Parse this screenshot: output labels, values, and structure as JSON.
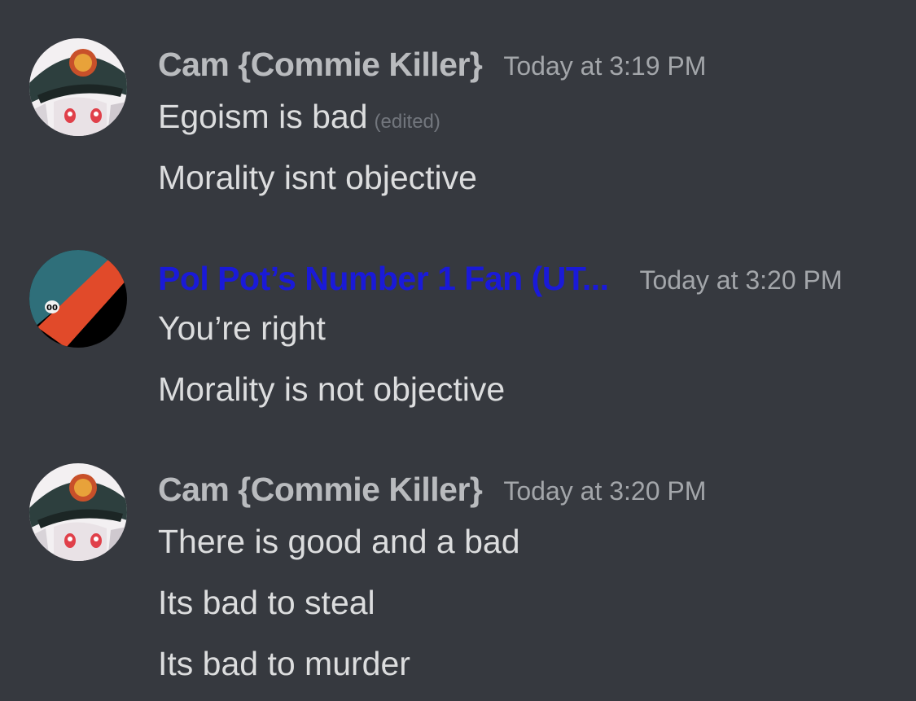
{
  "colors": {
    "background": "#36393f",
    "message_text": "#dcddde",
    "timestamp": "#a3a6aa",
    "edited": "#72767d",
    "username_cam": "#b9bbbe",
    "username_polpot": "#1a1ad8"
  },
  "messages": [
    {
      "author": "Cam {Commie Killer}",
      "timestamp": "Today at 3:19 PM",
      "avatar_icon": "anime-officer-avatar",
      "lines": [
        {
          "text": "Egoism is bad",
          "edited_tag": "(edited)"
        },
        {
          "text": "Morality isnt objective"
        }
      ]
    },
    {
      "author": "Pol Pot’s Number 1 Fan (UT...",
      "timestamp": "Today at 3:20 PM",
      "avatar_icon": "red-teal-flag-avatar",
      "lines": [
        {
          "text": "You’re right"
        },
        {
          "text": "Morality is not objective"
        }
      ]
    },
    {
      "author": "Cam {Commie Killer}",
      "timestamp": "Today at 3:20 PM",
      "avatar_icon": "anime-officer-avatar",
      "lines": [
        {
          "text": "There is good and a bad"
        },
        {
          "text": "Its bad to steal"
        },
        {
          "text": "Its bad to murder"
        }
      ]
    }
  ]
}
